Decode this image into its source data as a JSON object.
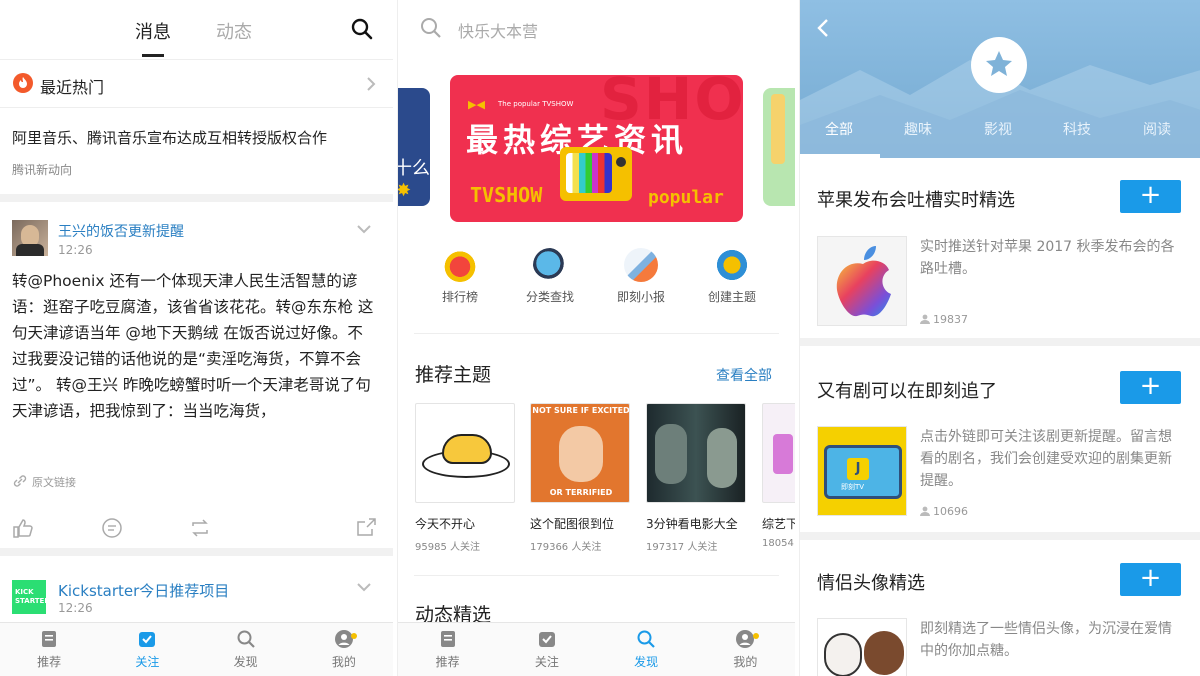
{
  "panel1": {
    "tabs": [
      "消息",
      "动态"
    ],
    "hot": {
      "label": "最近热门"
    },
    "news": {
      "title": "阿里音乐、腾讯音乐宣布达成互相转授版权合作",
      "source": "腾讯新动向"
    },
    "post1": {
      "author": "王兴的饭否更新提醒",
      "time": "12:26",
      "body": "转@Phoenix 还有一个体现天津人民生活智慧的谚语：逛窑子吃豆腐渣，该省省该花花。转@东东枪 这句天津谚语当年 @地下天鹅绒 在饭否说过好像。不过我要没记错的话他说的是“卖淫吃海货，不算不会过”。 转@王兴 昨晚吃螃蟹时听一个天津老哥说了句天津谚语，把我惊到了：当当吃海货，",
      "link": "原文链接"
    },
    "post2": {
      "author": "Kickstarter今日推荐项目",
      "time": "12:26",
      "avatar_text": "KICK STARTER"
    },
    "nav": [
      "推荐",
      "关注",
      "发现",
      "我的"
    ]
  },
  "panel2": {
    "search_placeholder": "快乐大本营",
    "banner": {
      "small": "The popular TVSHOW",
      "title": "最热综艺资讯",
      "tv": "TVSHOW",
      "popular": "popular",
      "side_text": "十么"
    },
    "quick": [
      "排行榜",
      "分类查找",
      "即刻小报",
      "创建主题"
    ],
    "recommend": {
      "title": "推荐主题",
      "more": "查看全部"
    },
    "cards": [
      {
        "title": "今天不开心",
        "followers": "95985 人关注"
      },
      {
        "title": "这个配图很到位",
        "followers": "179366 人关注",
        "meme_top": "NOT SURE IF EXCITED",
        "meme_bottom": "OR TERRIFIED"
      },
      {
        "title": "3分钟看电影大全",
        "followers": "197317 人关注"
      },
      {
        "title": "综艺下",
        "followers": "18054"
      }
    ],
    "dynamic": {
      "title": "动态精选"
    },
    "nav": [
      "推荐",
      "关注",
      "发现",
      "我的"
    ]
  },
  "panel3": {
    "categories": [
      "全部",
      "趣味",
      "影视",
      "科技",
      "阅读"
    ],
    "sections": [
      {
        "title": "苹果发布会吐槽实时精选",
        "desc": "实时推送针对苹果 2017 秋季发布会的各路吐槽。",
        "count": "19837"
      },
      {
        "title": "又有剧可以在即刻追了",
        "desc": "点击外链即可关注该剧更新提醒。留言想看的剧名，我们会创建受欢迎的剧集更新提醒。",
        "count": "10696",
        "tv_label": "即刻TV"
      },
      {
        "title": "情侣头像精选",
        "desc": "即刻精选了一些情侣头像，为沉浸在爱情中的你加点糖。"
      }
    ],
    "plus": "+"
  },
  "colors": {
    "accent": "#1a9ae8",
    "banner_red": "#f0304f",
    "hot_orange": "#f35a2b"
  }
}
